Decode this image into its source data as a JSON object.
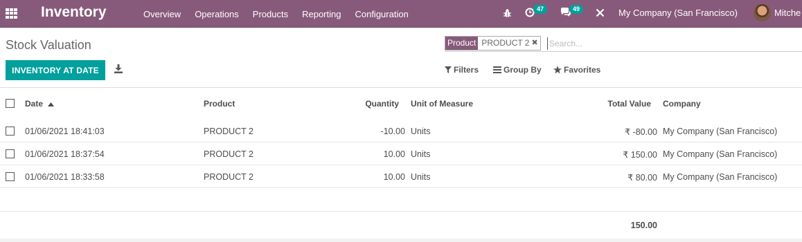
{
  "navbar": {
    "app_title": "Inventory",
    "menu": [
      "Overview",
      "Operations",
      "Products",
      "Reporting",
      "Configuration"
    ],
    "activity_count": "47",
    "message_count": "49",
    "company": "My Company (San Francisco)",
    "user": "Mitche"
  },
  "control_panel": {
    "breadcrumb": "Stock Valuation",
    "primary_button": "INVENTORY AT DATE",
    "search": {
      "facet_label": "Product",
      "facet_value": "PRODUCT 2",
      "placeholder": "Search..."
    },
    "filters_label": "Filters",
    "group_by_label": "Group By",
    "favorites_label": "Favorites"
  },
  "table": {
    "columns": {
      "date": "Date",
      "product": "Product",
      "quantity": "Quantity",
      "uom": "Unit of Measure",
      "total_value": "Total Value",
      "company": "Company"
    },
    "sort": "Date ascending",
    "rows": [
      {
        "date": "01/06/2021 18:41:03",
        "product": "PRODUCT 2",
        "quantity": "-10.00",
        "uom": "Units",
        "total_value": "₹ -80.00",
        "company": "My Company (San Francisco)"
      },
      {
        "date": "01/06/2021 18:37:54",
        "product": "PRODUCT 2",
        "quantity": "10.00",
        "uom": "Units",
        "total_value": "₹ 150.00",
        "company": "My Company (San Francisco)"
      },
      {
        "date": "01/06/2021 18:33:58",
        "product": "PRODUCT 2",
        "quantity": "10.00",
        "uom": "Units",
        "total_value": "₹ 80.00",
        "company": "My Company (San Francisco)"
      }
    ],
    "total": "150.00"
  },
  "colors": {
    "brand": "#875a7b",
    "accent": "#00a09d"
  }
}
